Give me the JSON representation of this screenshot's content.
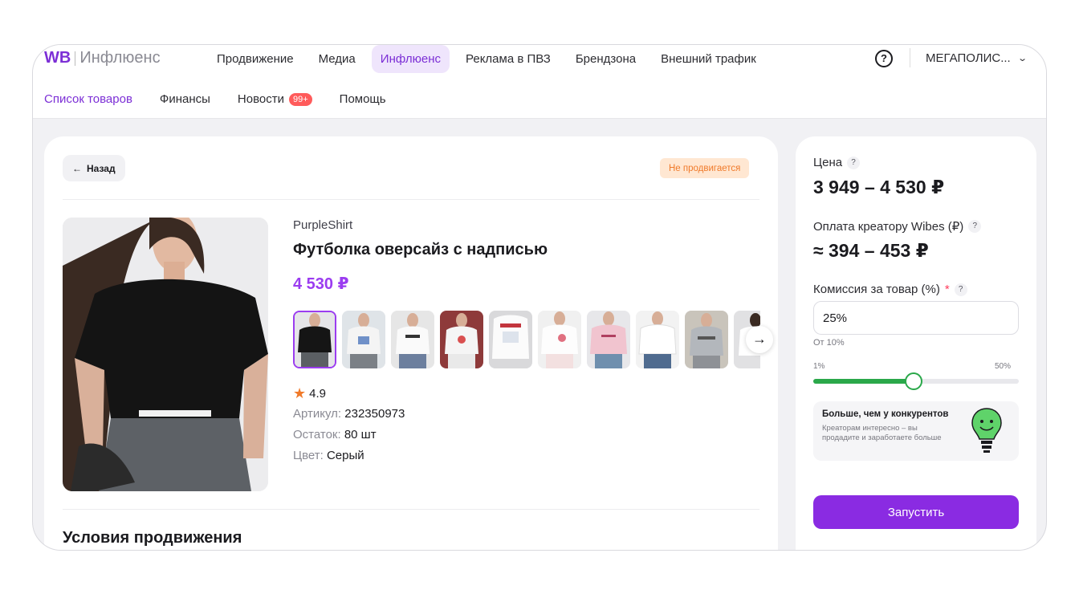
{
  "header": {
    "logo_wb": "WB",
    "logo_product": "Инфлюенс",
    "nav": [
      {
        "label": "Продвижение",
        "active": false
      },
      {
        "label": "Медиа",
        "active": false
      },
      {
        "label": "Инфлюенс",
        "active": true
      },
      {
        "label": "Реклама в ПВЗ",
        "active": false
      },
      {
        "label": "Брендзона",
        "active": false
      },
      {
        "label": "Внешний трафик",
        "active": false
      }
    ],
    "help_symbol": "?",
    "account": "МЕГАПОЛИС..."
  },
  "subnav": [
    {
      "label": "Список товаров",
      "active": true
    },
    {
      "label": "Финансы",
      "active": false
    },
    {
      "label": "Новости",
      "badge": "99+"
    },
    {
      "label": "Помощь",
      "active": false
    }
  ],
  "product": {
    "back_label": "Назад",
    "status": "Не продвигается",
    "brand": "PurpleShirt",
    "title": "Футболка оверсайз с надписью",
    "price": "4 530 ₽",
    "thumbnail_count": 10,
    "rating": "4.9",
    "article_label": "Артикул:",
    "article_value": "232350973",
    "stock_label": "Остаток:",
    "stock_value": "80 шт",
    "color_label": "Цвет:",
    "color_value": "Серый",
    "conditions_title": "Условия продвижения"
  },
  "side": {
    "price_label": "Цена",
    "price_value": "3 949 – 4 530 ₽",
    "payout_label": "Оплата креатору Wibes (₽)",
    "payout_value": "≈ 394 – 453 ₽",
    "commission_label": "Комиссия за товар (%)",
    "required_mark": "*",
    "commission_value": "25%",
    "commission_hint": "От 10%",
    "range_min": "1%",
    "range_max": "50%",
    "slider_fraction": 0.49,
    "promo_title": "Больше, чем у конкурентов",
    "promo_text": "Креаторам интересно – вы продадите и заработаете больше",
    "launch_label": "Запустить"
  },
  "colors": {
    "accent": "#8a2be2",
    "accent_text": "#9b3cf0",
    "slider_green": "#2aa84a",
    "status_bg": "#ffe7d2",
    "status_text": "#f07a2a"
  }
}
